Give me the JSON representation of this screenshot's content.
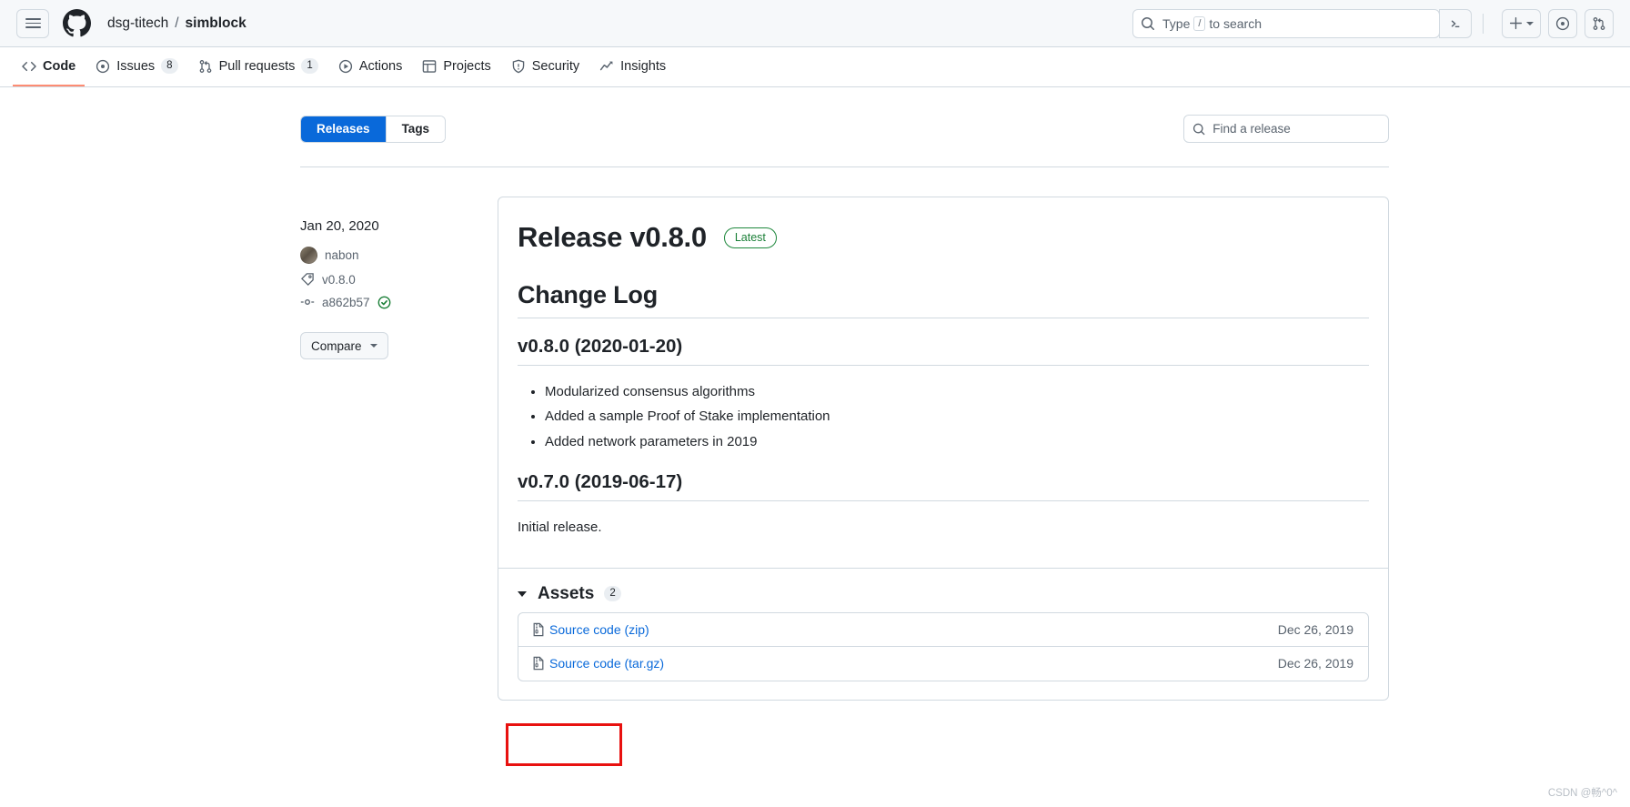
{
  "header": {
    "hamburger_icon": "hamburger-menu-icon",
    "logo_icon": "github-mark-icon",
    "breadcrumb": {
      "owner": "dsg-titech",
      "separator": "/",
      "repo": "simblock"
    },
    "search": {
      "icon": "search-icon",
      "placeholder_prefix": "Type",
      "slash_key": "/",
      "placeholder_suffix": "to search",
      "terminal_icon": "command-palette-icon"
    },
    "actions": {
      "create_new_icon": "plus-icon",
      "create_new_caret": "chevron-down-icon",
      "issues_icon": "issue-opened-icon",
      "pull_requests_icon": "git-pull-request-icon"
    }
  },
  "repo_nav": {
    "tabs": [
      {
        "label": "Code",
        "icon": "code-icon",
        "count": null,
        "active": true
      },
      {
        "label": "Issues",
        "icon": "issue-opened-icon",
        "count": "8",
        "active": false
      },
      {
        "label": "Pull requests",
        "icon": "git-pull-request-icon",
        "count": "1",
        "active": false
      },
      {
        "label": "Actions",
        "icon": "play-icon",
        "count": null,
        "active": false
      },
      {
        "label": "Projects",
        "icon": "table-icon",
        "count": null,
        "active": false
      },
      {
        "label": "Security",
        "icon": "shield-icon",
        "count": null,
        "active": false
      },
      {
        "label": "Insights",
        "icon": "graph-icon",
        "count": null,
        "active": false
      }
    ]
  },
  "toolbar": {
    "segments": [
      {
        "label": "Releases",
        "active": true
      },
      {
        "label": "Tags",
        "active": false
      }
    ],
    "find_release": {
      "icon": "search-icon",
      "placeholder": "Find a release",
      "value": ""
    }
  },
  "release": {
    "meta": {
      "date": "Jan 20, 2020",
      "author": {
        "name": "nabon",
        "avatar_icon": "user-avatar"
      },
      "tag": {
        "name": "v0.8.0",
        "icon": "tag-icon"
      },
      "commit": {
        "sha": "a862b57",
        "icon": "git-commit-icon",
        "verified_icon": "verified-check-icon"
      },
      "compare_button": {
        "label": "Compare",
        "caret_icon": "chevron-down-icon"
      }
    },
    "title": "Release v0.8.0",
    "latest_badge": "Latest",
    "changelog_heading": "Change Log",
    "sections": [
      {
        "heading": "v0.8.0 (2020-01-20)",
        "bullets": [
          "Modularized consensus algorithms",
          "Added a sample Proof of Stake implementation",
          "Added network parameters in 2019"
        ],
        "paragraph": null
      },
      {
        "heading": "v0.7.0 (2019-06-17)",
        "bullets": [],
        "paragraph": "Initial release."
      }
    ],
    "assets": {
      "title": "Assets",
      "count": "2",
      "collapse_icon": "triangle-down-icon",
      "rows": [
        {
          "name": "Source code (zip)",
          "icon": "file-zip-icon",
          "date": "Dec 26, 2019",
          "highlighted": true
        },
        {
          "name": "Source code (tar.gz)",
          "icon": "file-zip-icon",
          "date": "Dec 26, 2019",
          "highlighted": false
        }
      ]
    }
  },
  "watermark": "CSDN @畅^0^",
  "colors": {
    "accent_blue": "#0969da",
    "success_green": "#1a7f37",
    "border": "#d1d9e0",
    "canvas_subtle": "#f6f8fa",
    "text_primary": "#1f2328",
    "text_muted": "#59636e",
    "annotation_red": "#e8110f",
    "active_tab_underline": "#fd8c73"
  }
}
